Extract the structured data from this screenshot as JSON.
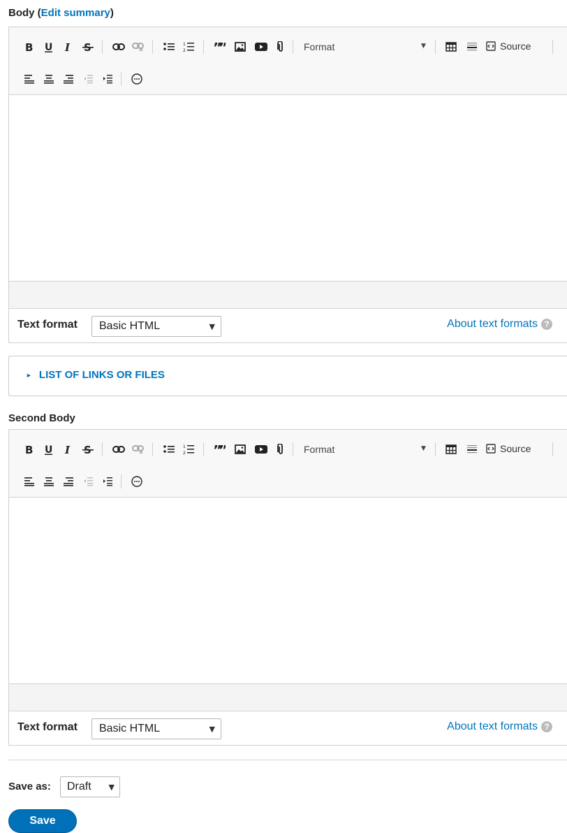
{
  "body_field": {
    "label": "Body",
    "open_paren": " (",
    "edit_summary_link": "Edit summary",
    "close_paren": ")",
    "toolbar": {
      "format_label": "Format",
      "source_label": "Source"
    },
    "text_format": {
      "label": "Text format",
      "selected": "Basic HTML",
      "about_link": "About text formats"
    }
  },
  "details": {
    "summary": "LIST OF LINKS OR FILES"
  },
  "second_body_field": {
    "label": "Second Body",
    "toolbar": {
      "format_label": "Format",
      "source_label": "Source"
    },
    "text_format": {
      "label": "Text format",
      "selected": "Basic HTML",
      "about_link": "About text formats"
    }
  },
  "moderation": {
    "label": "Save as:",
    "selected": "Draft"
  },
  "actions": {
    "save_label": "Save"
  },
  "colors": {
    "link": "#0074bd",
    "primary_button": "#0071b8"
  },
  "icons": {
    "details_toggle": "triangle-right-icon",
    "help": "question-circle-icon",
    "select_caret": "caret-down-icon"
  }
}
